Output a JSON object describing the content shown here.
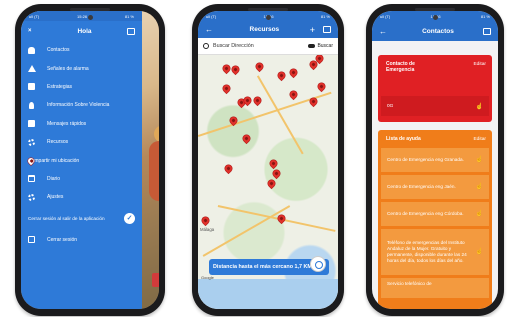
{
  "phone1": {
    "status": {
      "time": "15:26",
      "left": "ull (T)",
      "right": "81 %"
    },
    "drawer": {
      "close": "×",
      "title": "Hola",
      "items": [
        {
          "label": "Contactos",
          "icon": "contacts-icon"
        },
        {
          "label": "Señales de alarma",
          "icon": "warning-icon"
        },
        {
          "label": "Estrategias",
          "icon": "strategies-icon"
        },
        {
          "label": "Información Sobre Violencia",
          "icon": "lightbulb-icon"
        },
        {
          "label": "Mensajes rápidos",
          "icon": "chat-icon"
        },
        {
          "label": "Recursos",
          "icon": "resources-icon"
        },
        {
          "label": "Compartir mi ubicación",
          "icon": "location-pin-icon"
        },
        {
          "label": "Diario",
          "icon": "calendar-icon"
        },
        {
          "label": "Ajustes",
          "icon": "settings-icon"
        }
      ],
      "toggle_label": "Cerrar sesión al salir de la aplicación",
      "logout": "Cerrar sesión"
    }
  },
  "phone2": {
    "status": {
      "time": "15:26",
      "left": "ull (T)",
      "right": "81 %"
    },
    "header": {
      "title": "Recursos",
      "back": "←",
      "add": "+"
    },
    "search": {
      "placeholder": "Buscar Dirección",
      "button": "Buscar"
    },
    "map": {
      "cities": [
        "Málaga"
      ]
    },
    "distance_banner": "Distancia hasta el más cercano 1,7 KM",
    "google_label": "Google"
  },
  "phone3": {
    "status": {
      "time": "15:26",
      "left": "ull (T)",
      "right": "81 %"
    },
    "header": {
      "title": "Contactos",
      "back": "←"
    },
    "emergency": {
      "title": "Contacto de Emergencia",
      "edit": "Editar",
      "number": "0G"
    },
    "help_list": {
      "title": "Lista de ayuda",
      "edit": "Editar",
      "items": [
        "Centro de Emergencia eng Granada.",
        "Centro de Emergencia eng Jaén.",
        "Centro de Emergencia eng Córdoba.",
        "Teléfono de emergencias del Instituto Andaluz de la Mujer. Gratuito y permanente, disponible durante las 24 horas del día, todos los días del año.",
        "Servicio telefónico de"
      ]
    }
  },
  "colors": {
    "primary_blue": "#2e7ad8",
    "emergency_red": "#e02024",
    "help_orange": "#f07d1a",
    "pin_red": "#e0312b"
  }
}
